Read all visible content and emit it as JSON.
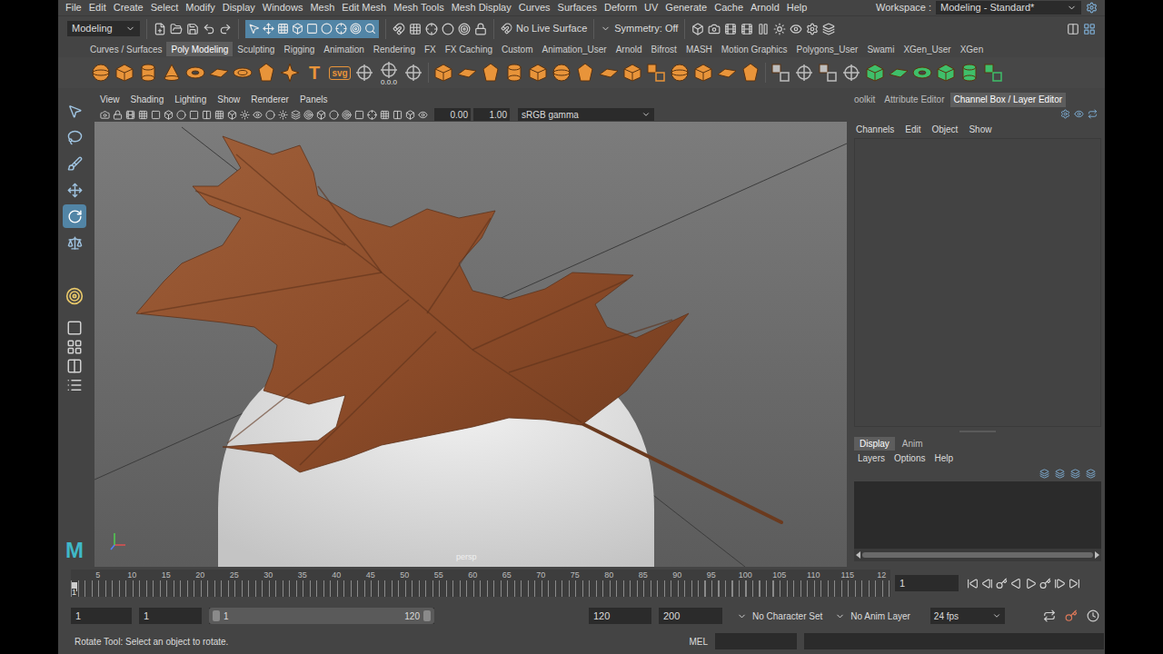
{
  "menu_bar": {
    "items": [
      "File",
      "Edit",
      "Create",
      "Select",
      "Modify",
      "Display",
      "Windows",
      "Mesh",
      "Edit Mesh",
      "Mesh Tools",
      "Mesh Display",
      "Curves",
      "Surfaces",
      "Deform",
      "UV",
      "Generate",
      "Cache",
      "Arnold",
      "Help"
    ],
    "workspace_label": "Workspace :",
    "workspace": "Modeling - Standard*"
  },
  "status_line": {
    "menu_set": "Modeling",
    "live_surface": "No Live Surface",
    "symmetry": "Symmetry: Off"
  },
  "shelf": {
    "tabs": [
      {
        "label": "Curves / Surfaces",
        "selected": false
      },
      {
        "label": "Poly Modeling",
        "selected": true
      },
      {
        "label": "Sculpting",
        "selected": false
      },
      {
        "label": "Rigging",
        "selected": false
      },
      {
        "label": "Animation",
        "selected": false
      },
      {
        "label": "Rendering",
        "selected": false
      },
      {
        "label": "FX",
        "selected": false
      },
      {
        "label": "FX Caching",
        "selected": false
      },
      {
        "label": "Custom",
        "selected": false
      },
      {
        "label": "Animation_User",
        "selected": false
      },
      {
        "label": "Arnold",
        "selected": false
      },
      {
        "label": "Bifrost",
        "selected": false
      },
      {
        "label": "MASH",
        "selected": false
      },
      {
        "label": "Motion Graphics",
        "selected": false
      },
      {
        "label": "Polygons_User",
        "selected": false
      },
      {
        "label": "Swami",
        "selected": false
      },
      {
        "label": "XGen_User",
        "selected": false
      },
      {
        "label": "XGen",
        "selected": false
      }
    ],
    "text_buttons": [
      "T",
      "svg"
    ],
    "pivot_label": "0.0.0"
  },
  "toolbox": {
    "tools": [
      {
        "selected": false
      },
      {
        "selected": false
      },
      {
        "selected": false
      },
      {
        "selected": false
      },
      {
        "selected": true
      },
      {
        "selected": false
      }
    ],
    "logo": "M"
  },
  "viewport": {
    "menu": [
      "View",
      "Shading",
      "Lighting",
      "Show",
      "Renderer",
      "Panels"
    ],
    "exposure": "0.00",
    "gamma": "1.00",
    "color_space": "sRGB gamma",
    "camera": "persp"
  },
  "right_panel": {
    "tabs": [
      {
        "label": "oolkit",
        "selected": false
      },
      {
        "label": "Attribute Editor",
        "selected": false
      },
      {
        "label": "Channel Box / Layer Editor",
        "selected": true
      }
    ],
    "channel_menu": [
      "Channels",
      "Edit",
      "Object",
      "Show"
    ],
    "layer_tabs": [
      {
        "label": "Display",
        "selected": true
      },
      {
        "label": "Anim",
        "selected": false
      }
    ],
    "layer_menu": [
      "Layers",
      "Options",
      "Help"
    ]
  },
  "timeline": {
    "ticks": [
      "5",
      "10",
      "15",
      "20",
      "25",
      "30",
      "35",
      "40",
      "45",
      "50",
      "55",
      "60",
      "65",
      "70",
      "75",
      "80",
      "85",
      "90",
      "95",
      "100",
      "105",
      "110",
      "115",
      "12"
    ],
    "start_frame": "1",
    "current_frame": "1"
  },
  "range_slider": {
    "start": "1",
    "playback_start": "1",
    "slider_start": "1",
    "slider_end": "120",
    "level": 1,
    "playback_end": "120",
    "end": "200",
    "character_set": "No Character Set",
    "anim_layer": "No Anim Layer",
    "fps": "24 fps"
  },
  "command_line": {
    "help": "Rotate Tool: Select an object to rotate.",
    "language": "MEL"
  }
}
